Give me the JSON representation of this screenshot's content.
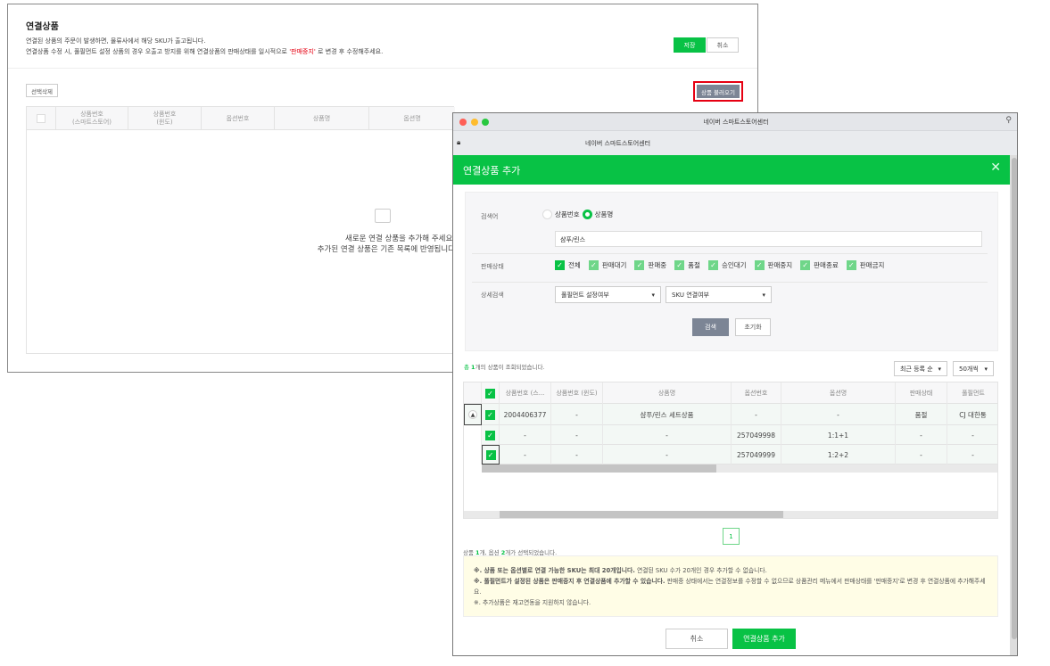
{
  "background_page": {
    "title": "연결상품",
    "desc1": "연결된 상품의 주문이 발생하면, 물류사에서 해당 SKU가 출고됩니다.",
    "desc2_pre": "연결상품 수정 시, 풀필먼트 설정 상품의 경우 오출고 방지를 위해 연결상품의 판매상태를 일시적으로 ",
    "desc2_highlight": "'판매중지'",
    "desc2_post": " 로 변경 후 수정해주세요.",
    "save_label": "저장",
    "cancel_label": "취소",
    "delete_selected_label": "선택삭제",
    "load_products_label": "상품 불러오기",
    "columns": [
      "상품번호\n(스마트스토어)",
      "상품번호\n(윈도)",
      "옵션번호",
      "상품명",
      "옵션명"
    ],
    "empty_line1": "새로운 연결 상품을 추가해 주세요.",
    "empty_line2": "추가된 연결 상품은 기존 목록에 반영됩니다",
    "highlight_color": "#e60012"
  },
  "window": {
    "title": "네이버 스마트스토어센터",
    "address": "네이버 스마트스토어센터"
  },
  "modal": {
    "title": "연결상품 추가",
    "accent_color": "#08c245",
    "search": {
      "keyword_label": "검색어",
      "radio_options": [
        {
          "label": "상품번호",
          "selected": false
        },
        {
          "label": "상품명",
          "selected": true
        }
      ],
      "keyword_value": "샴푸/린스",
      "status_label": "판매상태",
      "statuses": [
        "전체",
        "판매대기",
        "판매중",
        "품절",
        "승인대기",
        "판매중지",
        "판매종료",
        "판매금지"
      ],
      "detail_label": "상세검색",
      "select1": "풀필먼트 설정여부",
      "select2": "SKU 연결여부",
      "search_btn": "검색",
      "reset_btn": "초기화"
    },
    "result_prefix": "총 ",
    "result_count": "1",
    "result_suffix": "개의 상품이 조회되었습니다.",
    "sort_select": "최근 등록 순",
    "page_size_select": "50개씩",
    "columns": [
      "상품번호 (스...",
      "상품번호 (윈도)",
      "상품명",
      "옵션번호",
      "옵션명",
      "판매상태",
      "풀필먼트"
    ],
    "rows": [
      {
        "cells": [
          "2004406377",
          "-",
          "샴푸/린스 세트상품",
          "-",
          "-",
          "품절",
          "CJ 대한통"
        ],
        "checked": true
      },
      {
        "cells": [
          "-",
          "-",
          "-",
          "257049998",
          "1:1+1",
          "-",
          "-"
        ],
        "checked": true
      },
      {
        "cells": [
          "-",
          "-",
          "-",
          "257049999",
          "1:2+2",
          "-",
          "-"
        ],
        "checked": true
      }
    ],
    "page": "1",
    "selection": {
      "p1": "상품 ",
      "n1": "1",
      "p2": "개, 옵션 ",
      "n2": "2",
      "p3": "개가 선택되었습니다."
    },
    "notice": {
      "l1_bold": "※. 상품 또는 옵션별로 연결 가능한 SKU는 최대 20개입니다.",
      "l1": " 연결된 SKU 수가 20개인 경우 추가할 수 없습니다.",
      "l2_bold": "※. 풀필먼트가 설정된 상품은 판매중지 후 연결상품에 추가할 수 있습니다.",
      "l2": " 판매중 상태에서는 연결정보를 수정할 수 없으므로 상품관리 메뉴에서 판매상태를 '판매중지'로 변경 후 연결상품에 추가해주세요.",
      "l3": "※. 추가상품은 재고연동을 지원하지 않습니다."
    },
    "cancel_btn": "취소",
    "add_btn": "연결상품 추가"
  }
}
